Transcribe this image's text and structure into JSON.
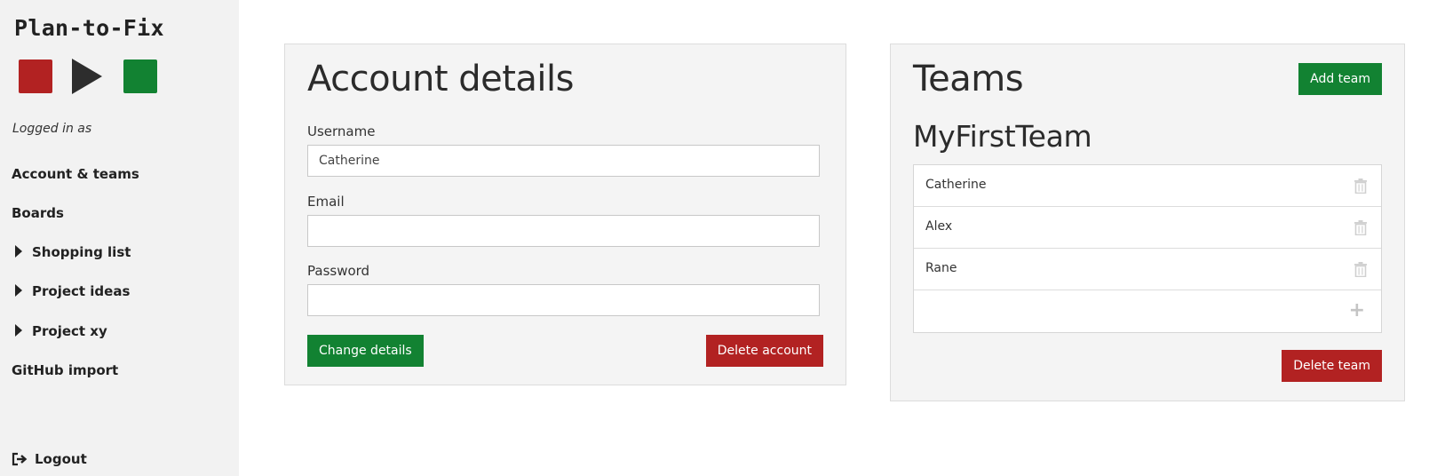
{
  "app": {
    "title": "Plan-to-Fix",
    "logo_icons": [
      "stop-icon",
      "play-icon",
      "go-icon"
    ]
  },
  "sidebar": {
    "logged_in_label": "Logged in as",
    "items": [
      {
        "label": "Account & teams",
        "collapsible": false
      },
      {
        "label": "Boards",
        "collapsible": false
      },
      {
        "label": "Shopping list",
        "collapsible": true
      },
      {
        "label": "Project ideas",
        "collapsible": true
      },
      {
        "label": "Project xy",
        "collapsible": true
      },
      {
        "label": "GitHub import",
        "collapsible": false
      }
    ],
    "logout_label": "Logout"
  },
  "account": {
    "title": "Account details",
    "username_label": "Username",
    "username_value": "Catherine",
    "email_label": "Email",
    "email_value": "",
    "password_label": "Password",
    "password_value": "",
    "change_button": "Change details",
    "delete_button": "Delete account"
  },
  "teams": {
    "title": "Teams",
    "add_button": "Add team",
    "team": {
      "name": "MyFirstTeam",
      "members": [
        "Catherine",
        "Alex",
        "Rane"
      ],
      "delete_button": "Delete team"
    }
  },
  "colors": {
    "green": "#128232",
    "red": "#b22222",
    "sidebar_bg": "#f2f2f2",
    "panel_bg": "#f4f4f4"
  }
}
